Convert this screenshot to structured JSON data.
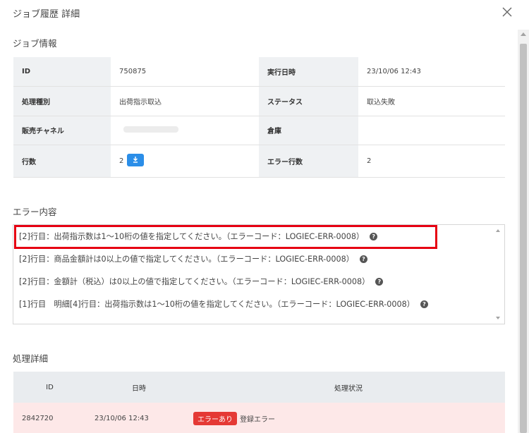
{
  "modal": {
    "title": "ジョブ履歴 詳細",
    "close_icon": "close-icon"
  },
  "job_info": {
    "heading": "ジョブ情報",
    "rows": [
      {
        "label1": "ID",
        "value1": "750875",
        "label2": "実行日時",
        "value2": "23/10/06 12:43"
      },
      {
        "label1": "処理種別",
        "value1": "出荷指示取込",
        "label2": "ステータス",
        "value2": "取込失敗"
      },
      {
        "label1": "販売チャネル",
        "value1": "",
        "label2": "倉庫",
        "value2": ""
      },
      {
        "label1": "行数",
        "value1": "2",
        "label2": "エラー行数",
        "value2": "2"
      }
    ],
    "download_icon": "download-icon"
  },
  "errors": {
    "heading": "エラー内容",
    "items": [
      "[2]行目：出荷指示数は1～10桁の値を指定してください。（エラーコード：LOGIEC-ERR-0008）",
      "[2]行目：商品金額計は0以上の値で指定してください。（エラーコード：LOGIEC-ERR-0008）",
      "[2]行目：金額計（税込）は0以上の値で指定してください。（エラーコード：LOGIEC-ERR-0008）",
      "[1]行目　明細[4]行目：出荷指示数は1～10桁の値を指定してください。（エラーコード：LOGIEC-ERR-0008）"
    ],
    "help_glyph": "?"
  },
  "process_detail": {
    "heading": "処理詳細",
    "columns": [
      "ID",
      "日時",
      "処理状況"
    ],
    "rows": [
      {
        "id": "2842720",
        "datetime": "23/10/06 12:43",
        "badge": "エラーあり",
        "status": "登録エラー"
      }
    ]
  },
  "colors": {
    "highlight": "#e60012",
    "badge": "#e53935",
    "download_button": "#2b8ee8",
    "error_row": "#fde8e8"
  }
}
